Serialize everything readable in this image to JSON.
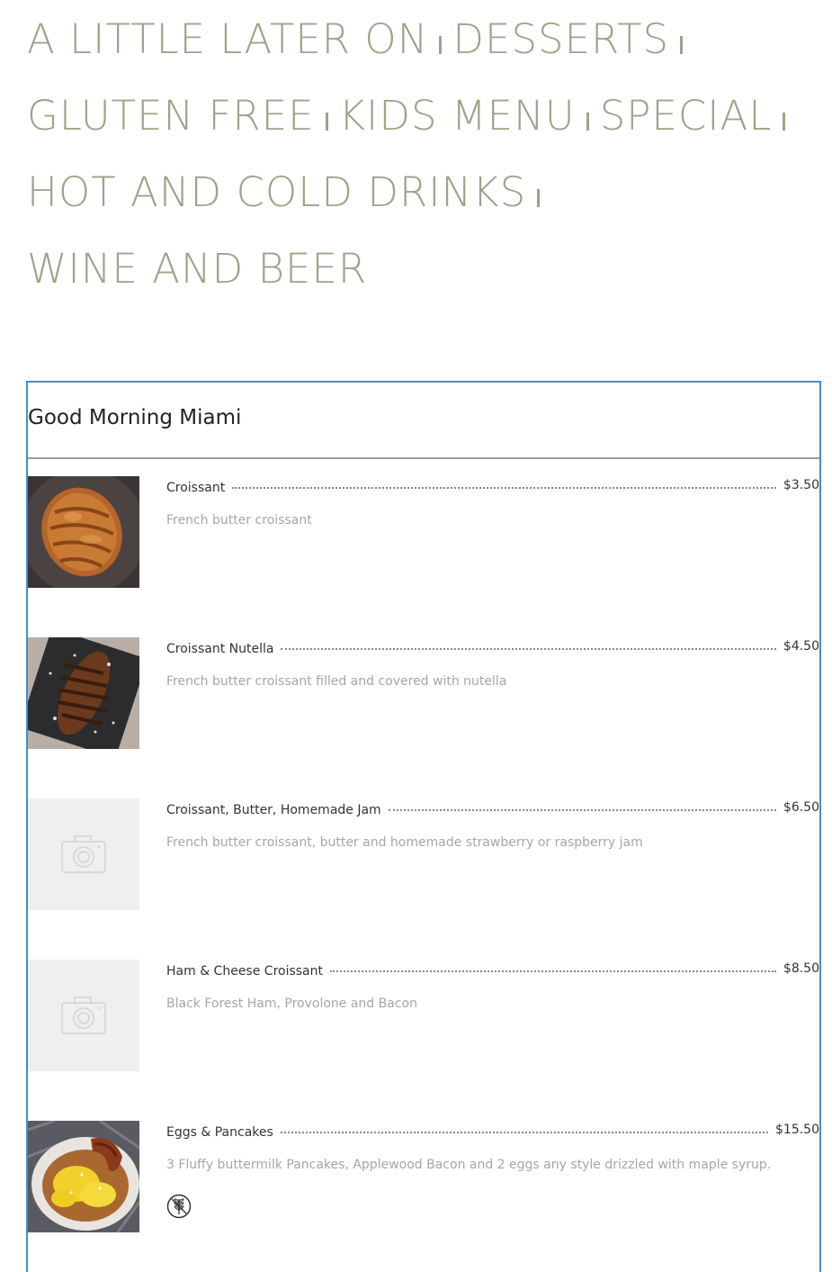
{
  "nav": {
    "links": [
      "A LITTLE LATER ON",
      "DESSERTS",
      "GLUTEN FREE",
      "KIDS MENU",
      "SPECIAL",
      "HOT AND COLD DRINKS",
      "WINE AND BEER"
    ]
  },
  "section": {
    "title": "Good Morning Miami",
    "items": [
      {
        "name": "Croissant",
        "price": "$3.50",
        "description": "French butter croissant",
        "image": "croissant-photo"
      },
      {
        "name": "Croissant Nutella",
        "price": "$4.50",
        "description": "French butter croissant filled and covered with nutella",
        "image": "nutella-croissant-photo"
      },
      {
        "name": "Croissant, Butter, Homemade Jam",
        "price": "$6.50",
        "description": "French butter croissant, butter and homemade strawberry or raspberry jam",
        "image": "camera-placeholder-icon"
      },
      {
        "name": "Ham & Cheese Croissant",
        "price": "$8.50",
        "description": "Black Forest Ham, Provolone and Bacon",
        "image": "camera-placeholder-icon"
      },
      {
        "name": "Eggs & Pancakes",
        "price": "$15.50",
        "description": "3 Fluffy buttermilk Pancakes, Applewood Bacon and 2 eggs any style drizzled with maple syrup.",
        "image": "eggs-pancakes-photo",
        "badge": "wheat-icon"
      }
    ]
  },
  "colors": {
    "nav_text": "#a3a08a",
    "frame_border": "#3f8fd2",
    "title_text": "#222222",
    "desc_text": "#a6a6a6"
  }
}
